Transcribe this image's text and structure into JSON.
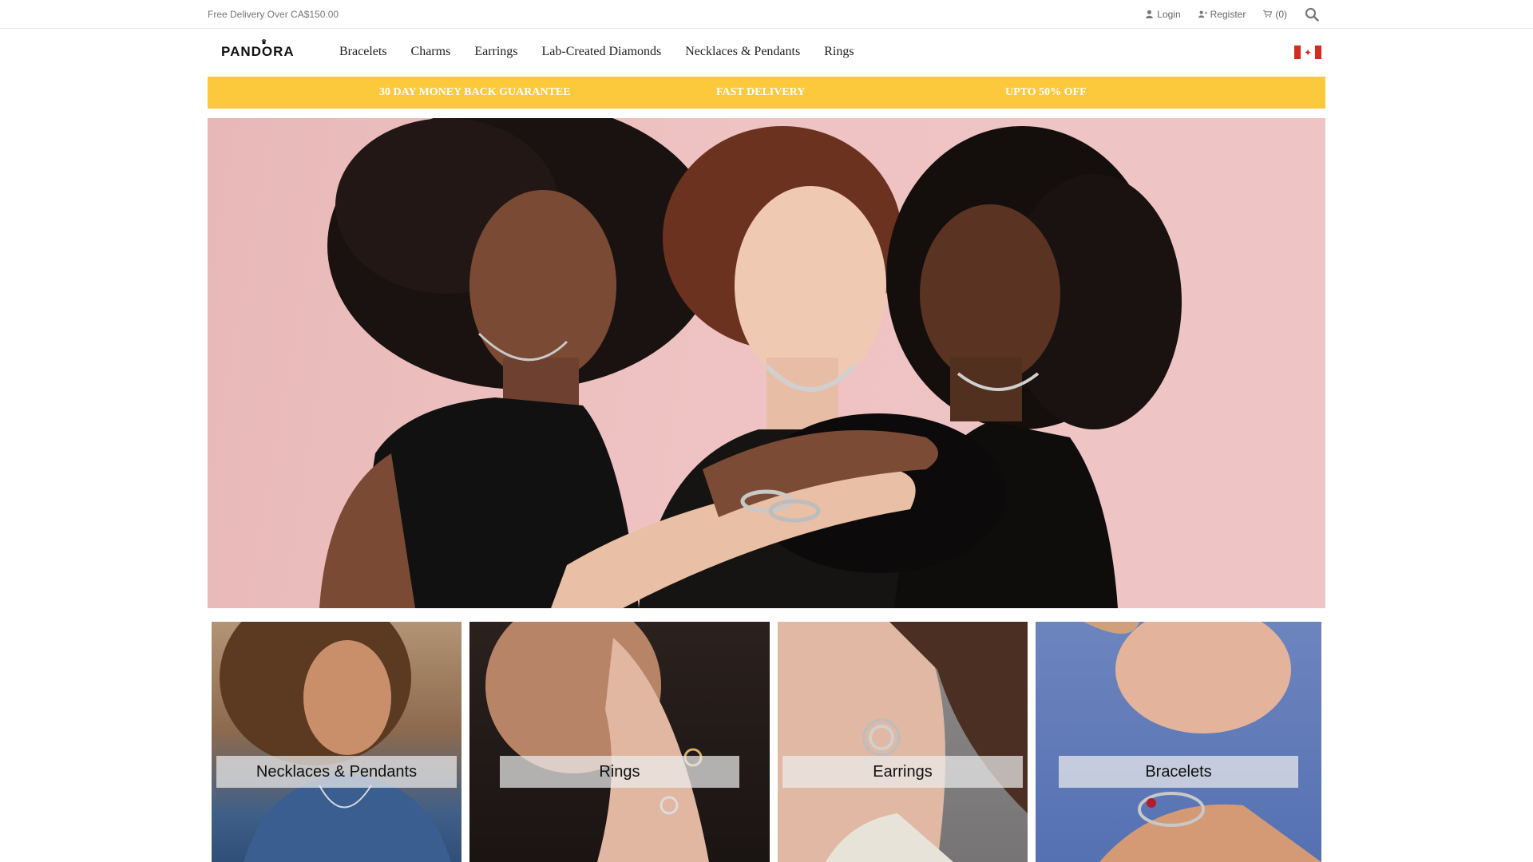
{
  "topbar": {
    "free_delivery": "Free Delivery Over CA$150.00",
    "login": "Login",
    "register": "Register",
    "cart": "(0)"
  },
  "brand": {
    "logo": "PANDORA"
  },
  "nav": {
    "items": [
      {
        "label": "Bracelets"
      },
      {
        "label": "Charms"
      },
      {
        "label": "Earrings"
      },
      {
        "label": "Lab-Created Diamonds"
      },
      {
        "label": "Necklaces & Pendants"
      },
      {
        "label": "Rings"
      }
    ]
  },
  "promo": {
    "left": "30 DAY MONEY BACK GUARANTEE",
    "center": "FAST DELIVERY",
    "right": "UPTO 50% OFF",
    "color": "#fcc93c"
  },
  "categories": [
    {
      "label": "Necklaces & Pendants"
    },
    {
      "label": "Rings"
    },
    {
      "label": "Earrings"
    },
    {
      "label": "Bracelets"
    }
  ],
  "icons": {
    "user": "user-icon",
    "register": "user-plus-icon",
    "cart": "cart-icon",
    "search": "search-icon",
    "flag": "canada-flag-icon"
  }
}
